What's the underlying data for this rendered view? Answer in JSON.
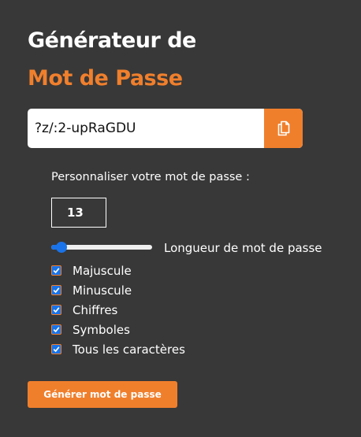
{
  "header": {
    "title_line1": "Générateur de",
    "title_line2": "Mot de Passe",
    "accent_color": "#f07f2c"
  },
  "password": {
    "value": "?z/:2-upRaGDU",
    "copy_icon": "copy-file-icon"
  },
  "settings": {
    "section_label": "Personnaliser votre mot de passe :",
    "length_value": "13",
    "slider_label": "Longueur de mot de passe",
    "slider_fraction": 0.1,
    "options": [
      {
        "label": "Majuscule",
        "checked": true
      },
      {
        "label": "Minuscule",
        "checked": true
      },
      {
        "label": "Chiffres",
        "checked": true
      },
      {
        "label": "Symboles",
        "checked": true
      },
      {
        "label": "Tous les caractères",
        "checked": true
      }
    ]
  },
  "actions": {
    "generate_label": "Générer mot de passe"
  },
  "colors": {
    "background": "#383838",
    "accent": "#f07f2c",
    "control_blue": "#1a73e8"
  }
}
